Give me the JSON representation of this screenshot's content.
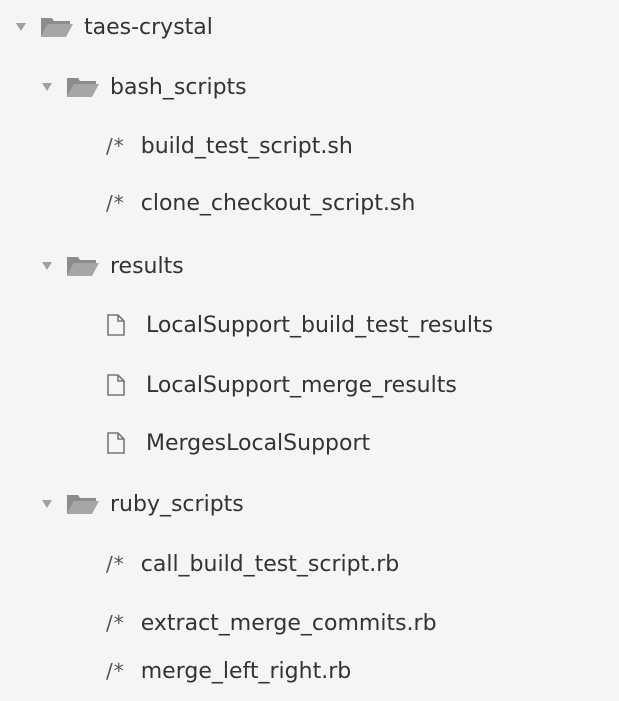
{
  "tree": {
    "root": {
      "name": "taes-crystal",
      "icon": "folder-open-icon",
      "children": {
        "bash_scripts": {
          "name": "bash_scripts",
          "files": [
            {
              "name": "build_test_script.sh",
              "icon": "code-comment-icon",
              "glyph": "/*"
            },
            {
              "name": "clone_checkout_script.sh",
              "icon": "code-comment-icon",
              "glyph": "/*"
            }
          ]
        },
        "results": {
          "name": "results",
          "files": [
            {
              "name": "LocalSupport_build_test_results",
              "icon": "file-icon"
            },
            {
              "name": "LocalSupport_merge_results",
              "icon": "file-icon"
            },
            {
              "name": "MergesLocalSupport",
              "icon": "file-icon"
            }
          ]
        },
        "ruby_scripts": {
          "name": "ruby_scripts",
          "files": [
            {
              "name": "call_build_test_script.rb",
              "icon": "code-comment-icon",
              "glyph": "/*"
            },
            {
              "name": "extract_merge_commits.rb",
              "icon": "code-comment-icon",
              "glyph": "/*"
            },
            {
              "name": "merge_left_right.rb",
              "icon": "code-comment-icon",
              "glyph": "/*"
            }
          ]
        }
      }
    }
  },
  "colors": {
    "background": "#f5f5f5",
    "folder": "#9a9a9a",
    "chevron": "#a0a0a0",
    "text": "#333333"
  }
}
